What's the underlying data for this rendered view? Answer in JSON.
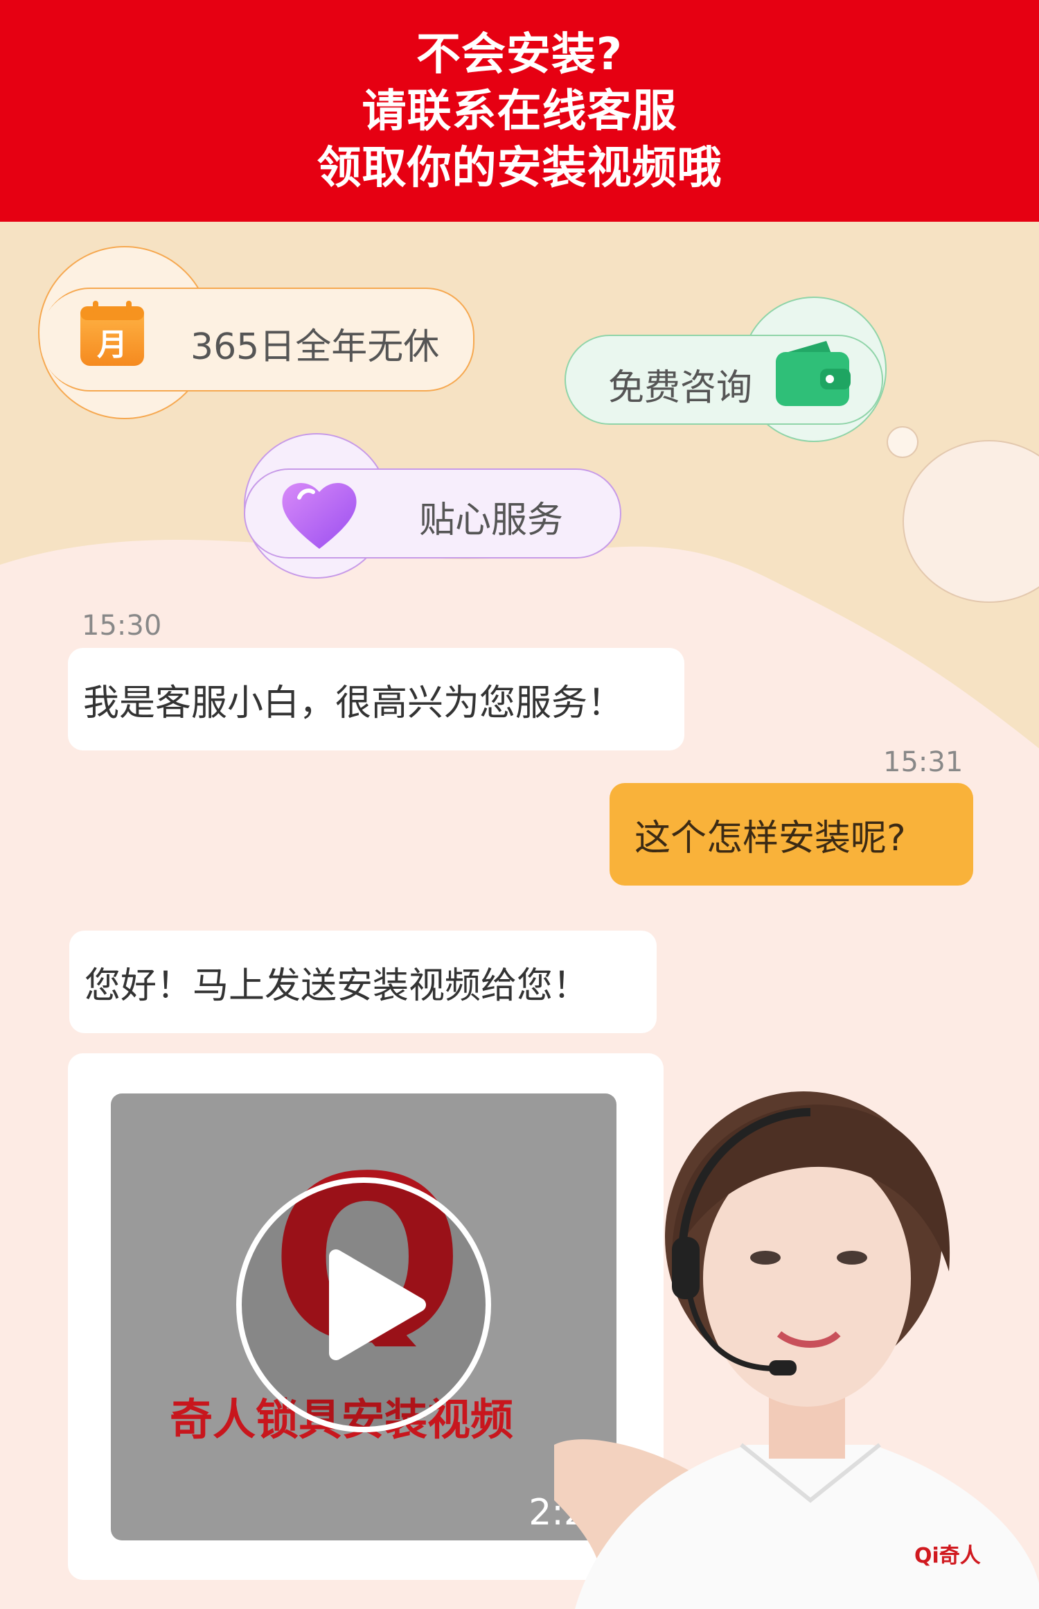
{
  "banner": {
    "line1": "不会安装?",
    "line2": "请联系在线客服",
    "line3": "领取你的安装视频哦"
  },
  "features": {
    "service_days": {
      "label": "365日全年无休",
      "icon": "calendar-icon",
      "icon_text": "月",
      "color": "#f7a033"
    },
    "free_consult": {
      "label": "免费咨询",
      "icon": "wallet-icon",
      "color": "#2fbf78"
    },
    "caring_service": {
      "label": "贴心服务",
      "icon": "heart-icon",
      "color": "#b25ef0"
    }
  },
  "chat": {
    "messages": [
      {
        "time": "15:30",
        "text": "我是客服小白，很高兴为您服务！",
        "from": "agent"
      },
      {
        "time": "15:31",
        "text": "这个怎样安装呢?",
        "from": "user"
      },
      {
        "text": "您好！马上发送安装视频给您！",
        "from": "agent"
      }
    ],
    "video": {
      "logo_text": "Qi",
      "title": "奇人锁具安装视频",
      "duration": "2:29"
    }
  },
  "agent_badge": "Qi奇人",
  "colors": {
    "banner_red": "#e60012",
    "user_bubble": "#f9b23a",
    "page_bg": "#f6e2c3",
    "chat_bg": "#fdebe4"
  }
}
